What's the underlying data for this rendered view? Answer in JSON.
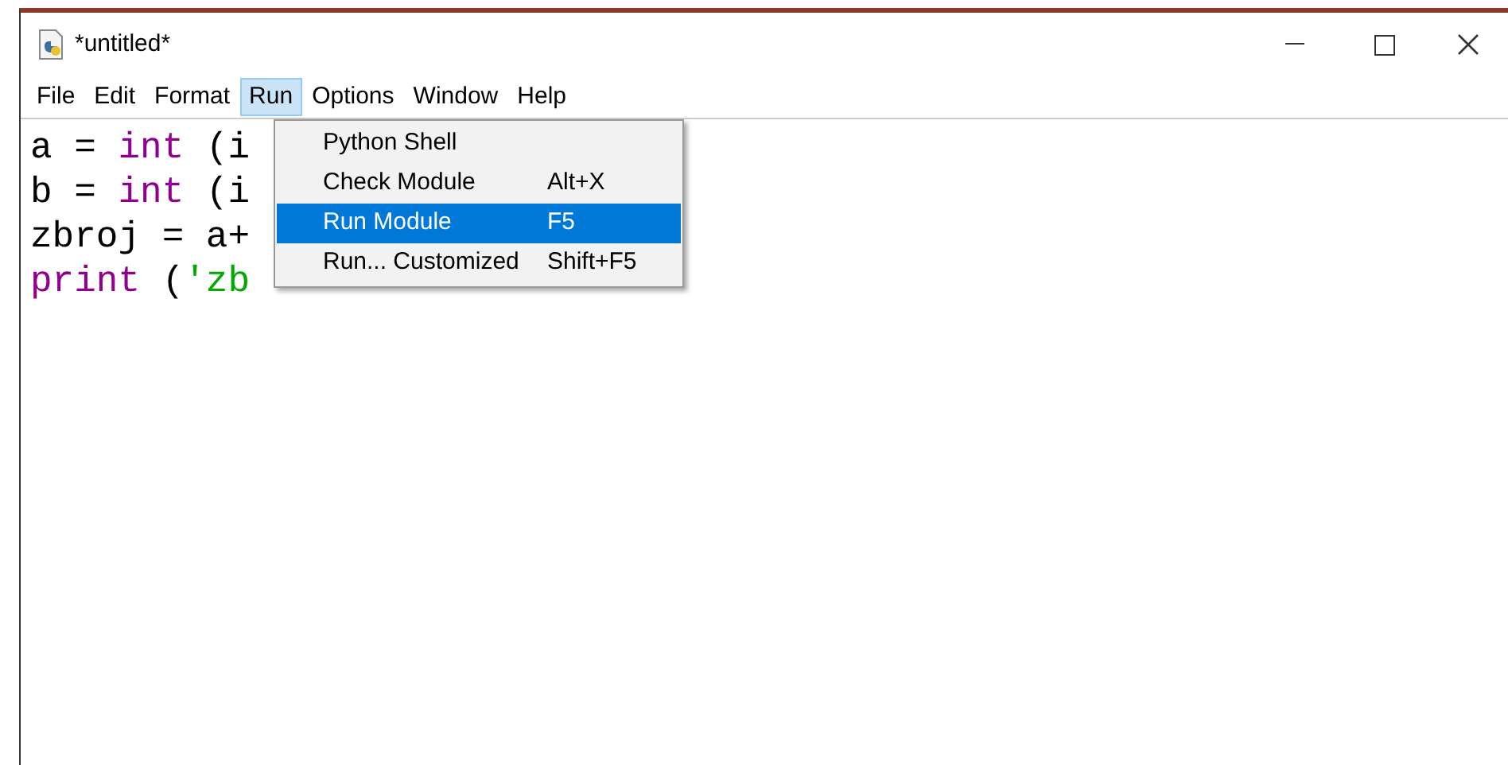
{
  "window": {
    "title": "*untitled*"
  },
  "menubar": [
    {
      "label": "File",
      "selected": false
    },
    {
      "label": "Edit",
      "selected": false
    },
    {
      "label": "Format",
      "selected": false
    },
    {
      "label": "Run",
      "selected": true
    },
    {
      "label": "Options",
      "selected": false
    },
    {
      "label": "Window",
      "selected": false
    },
    {
      "label": "Help",
      "selected": false
    }
  ],
  "editor": {
    "lines": [
      [
        {
          "text": "a = ",
          "kind": "plain"
        },
        {
          "text": "int",
          "kind": "builtin"
        },
        {
          "text": " (i",
          "kind": "plain"
        }
      ],
      [
        {
          "text": "b = ",
          "kind": "plain"
        },
        {
          "text": "int",
          "kind": "builtin"
        },
        {
          "text": " (i",
          "kind": "plain"
        }
      ],
      [
        {
          "text": "zbroj = a+",
          "kind": "plain"
        }
      ],
      [
        {
          "text": "print",
          "kind": "builtin"
        },
        {
          "text": " (",
          "kind": "plain"
        },
        {
          "text": "'zb",
          "kind": "string"
        }
      ]
    ]
  },
  "run_menu": [
    {
      "label": "Python Shell",
      "selected": false
    },
    {
      "label": "Check Module",
      "shortcut": "Alt+X",
      "selected": false
    },
    {
      "label": "Run Module",
      "shortcut": "F5",
      "selected": true
    },
    {
      "label": "Run... Customized",
      "shortcut": "Shift+F5",
      "selected": false
    }
  ]
}
